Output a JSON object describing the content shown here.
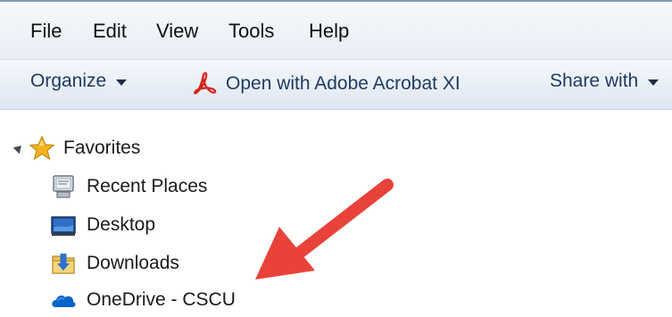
{
  "menu": {
    "items": [
      "File",
      "Edit",
      "View",
      "Tools",
      "Help"
    ]
  },
  "toolbar": {
    "organize_label": "Organize",
    "open_with_label": "Open with Adobe Acrobat XI",
    "share_with_label": "Share with"
  },
  "nav": {
    "favorites_label": "Favorites",
    "items": [
      {
        "label": "Recent Places",
        "icon": "recent-places-icon"
      },
      {
        "label": "Desktop",
        "icon": "desktop-icon"
      },
      {
        "label": "Downloads",
        "icon": "downloads-icon"
      },
      {
        "label": "OneDrive - CSCU",
        "icon": "onedrive-icon"
      }
    ]
  },
  "annotation": {
    "arrow_color": "#e8423a"
  },
  "colors": {
    "toolbar_text": "#1f3b63",
    "favorites_star": "#f2b322"
  }
}
